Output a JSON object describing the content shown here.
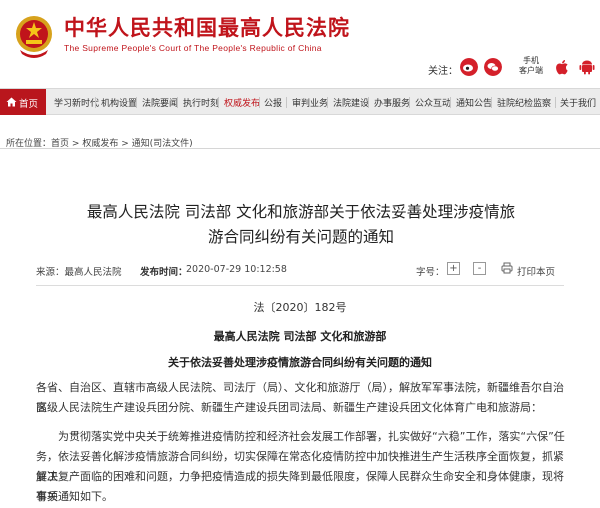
{
  "header": {
    "site_title": "中华人民共和国最高人民法院",
    "site_subtitle": "The Supreme People's Court of The People's Republic of China",
    "follow_label": "关注：",
    "mobile_client_line1": "手机",
    "mobile_client_line2": "客户端",
    "colors": {
      "brand_red": "#c0141b"
    }
  },
  "nav": {
    "home": "首页",
    "items": [
      "学习新时代",
      "机构设置",
      "法院要闻",
      "执行时刻",
      "权威发布",
      "公报",
      "审判业务",
      "法院建设",
      "办事服务",
      "公众互动",
      "通知公告",
      "驻院纪检监察",
      "关于我们"
    ]
  },
  "breadcrumb": {
    "prefix": "所在位置：",
    "items": [
      "首页",
      "权威发布",
      "通知(司法文件)"
    ],
    "separator": ">"
  },
  "article": {
    "title_line1": "最高人民法院 司法部 文化和旅游部关于依法妥善处理涉疫情旅",
    "title_line2": "游合同纠纷有关问题的通知",
    "source": "来源：最高人民法院",
    "publish_time_label": "发布时间：",
    "publish_time": "2020-07-29 10:12:58",
    "font_size_label": "字号：",
    "font_plus": "+",
    "font_minus": "-",
    "print_label": "打印本页",
    "doc_number": "法〔2020〕182号",
    "issuers": "最高人民法院 司法部 文化和旅游部",
    "notice_title": "关于依法妥善处理涉疫情旅游合同纠纷有关问题的通知",
    "addressee_line1": "各省、自治区、直辖市高级人民法院、司法厅（局）、文化和旅游厅（局），解放军军事法院，新疆维吾尔自治区",
    "addressee_line2": "高级人民法院生产建设兵团分院、新疆生产建设兵团司法局、新疆生产建设兵团文化体育广电和旅游局：",
    "body_line1": "为贯彻落实党中央关于统筹推进疫情防控和经济社会发展工作部署，扎实做好“六稳”工作，落实“六保”任",
    "body_line2": "务，依法妥善化解涉疫情旅游合同纠纷，切实保障在常态化疫情防控中加快推进生产生活秩序全面恢复，抓紧解决",
    "body_line3": "复工复产面临的困难和问题，力争把疫情造成的损失降到最低限度，保障人民群众生命安全和身体健康，现将有关",
    "body_line4": "事项通知如下。"
  }
}
